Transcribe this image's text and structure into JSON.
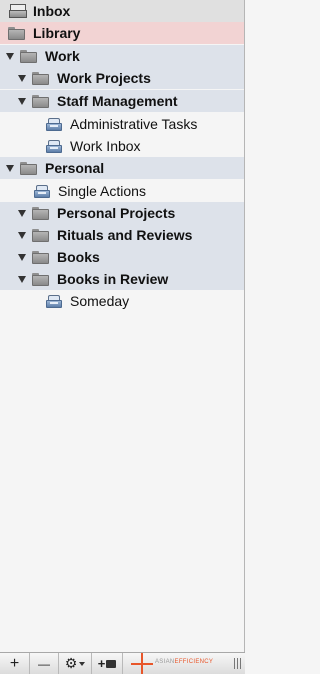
{
  "sidebar": {
    "rows": [
      {
        "label": "Inbox"
      },
      {
        "label": "Library"
      },
      {
        "label": "Work"
      },
      {
        "label": "Work Projects"
      },
      {
        "label": "Staff Management"
      },
      {
        "label": "Administrative Tasks"
      },
      {
        "label": "Work Inbox"
      },
      {
        "label": "Personal"
      },
      {
        "label": "Single Actions"
      },
      {
        "label": "Personal Projects"
      },
      {
        "label": "Rituals and Reviews"
      },
      {
        "label": "Books"
      },
      {
        "label": "Books in Review"
      },
      {
        "label": "Someday"
      }
    ]
  },
  "toolbar": {
    "add_label": "+",
    "remove_label": "—",
    "gear_label": "⚙",
    "add_folder_label": "+",
    "brand_part1": "ASIAN",
    "brand_part2": "EFFICIENCY"
  },
  "colors": {
    "selected_row": "#f2d3d3",
    "group_row": "#dde2ea",
    "brand_accent": "#e8562a"
  }
}
